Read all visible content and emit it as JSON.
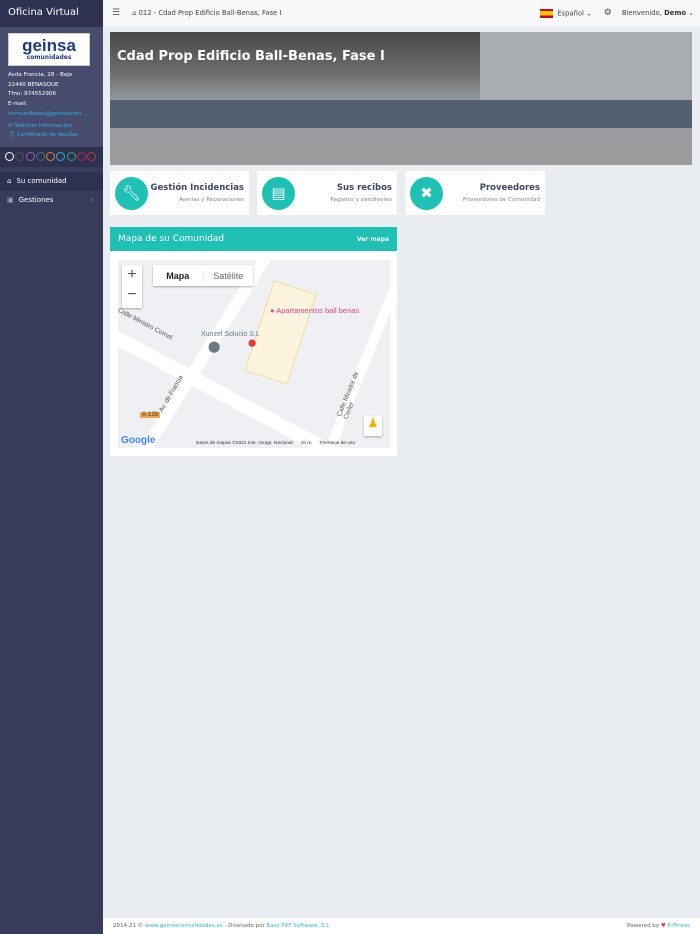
{
  "sidebar": {
    "title": "Oficina Virtual",
    "logo": {
      "main": "geinsa",
      "sub": "comunidades"
    },
    "address": [
      "Avda Francia, 28 - Bajo",
      "22440 BENASQUE",
      "Tfno: 974552906",
      "E-mail:"
    ],
    "email": "comunidades@geinsacom...",
    "links": [
      {
        "label": "Solicitar Información",
        "icon": "envelope-icon"
      },
      {
        "label": "Certificado de deudas",
        "icon": "certificate-icon"
      }
    ],
    "theme_colors": [
      "#ffffff",
      "#555555",
      "#9b59b6",
      "#4a6b7a",
      "#e67e22",
      "#1fb5d6",
      "#27ae60",
      "#c2185b",
      "#c0392b"
    ],
    "menu": [
      {
        "label": "Su comunidad",
        "icon": "home-icon",
        "active": true
      },
      {
        "label": "Gestiones",
        "icon": "briefcase-icon",
        "active": false
      }
    ]
  },
  "topbar": {
    "breadcrumb": "012 - Cdad Prop Edificio Ball-Benas, Fase I",
    "language": "Español",
    "welcome": "Bienvenido,",
    "user": "Demo"
  },
  "banner": {
    "title": "Cdad Prop Edificio Ball-Benas, Fase I"
  },
  "cards": [
    {
      "title": "Gestión Incidencias",
      "subtitle": "Averías y Reparaciones",
      "icon": "wrench-icon"
    },
    {
      "title": "Sus recibos",
      "subtitle": "Pagados y pendientes",
      "icon": "receipt-icon"
    },
    {
      "title": "Proveedores",
      "subtitle": "Proveedores de Comunidad",
      "icon": "tools-icon"
    }
  ],
  "map_panel": {
    "title": "Mapa de su Comunidad",
    "link": "Ver mapa",
    "map_type": [
      "Mapa",
      "Satélite"
    ],
    "labels": {
      "poi": "Apartamentos ball benas",
      "business": "Xunzel Solucio    S.L",
      "street1": "Calle Ministro Cornel",
      "street2": "Av. de Francia",
      "street3": "Calle Mirador de Cerler",
      "road": "A-139"
    },
    "attribution": "Datos de mapas ©2021 Inst. Geogr. Nacional",
    "scale": "10 m",
    "terms": "Términos de uso",
    "google": "Google"
  },
  "footer": {
    "copyright": "2014-21 ©",
    "site": "www.geinsacomunidades.es",
    "designed": "- Diseñado por",
    "designer": "Easy PVF Software, S.L.",
    "powered": "Powered by",
    "brand": "E-Fincas"
  },
  "colors": {
    "accent": "#1fc1b4",
    "sidebar": "#373c5b"
  }
}
